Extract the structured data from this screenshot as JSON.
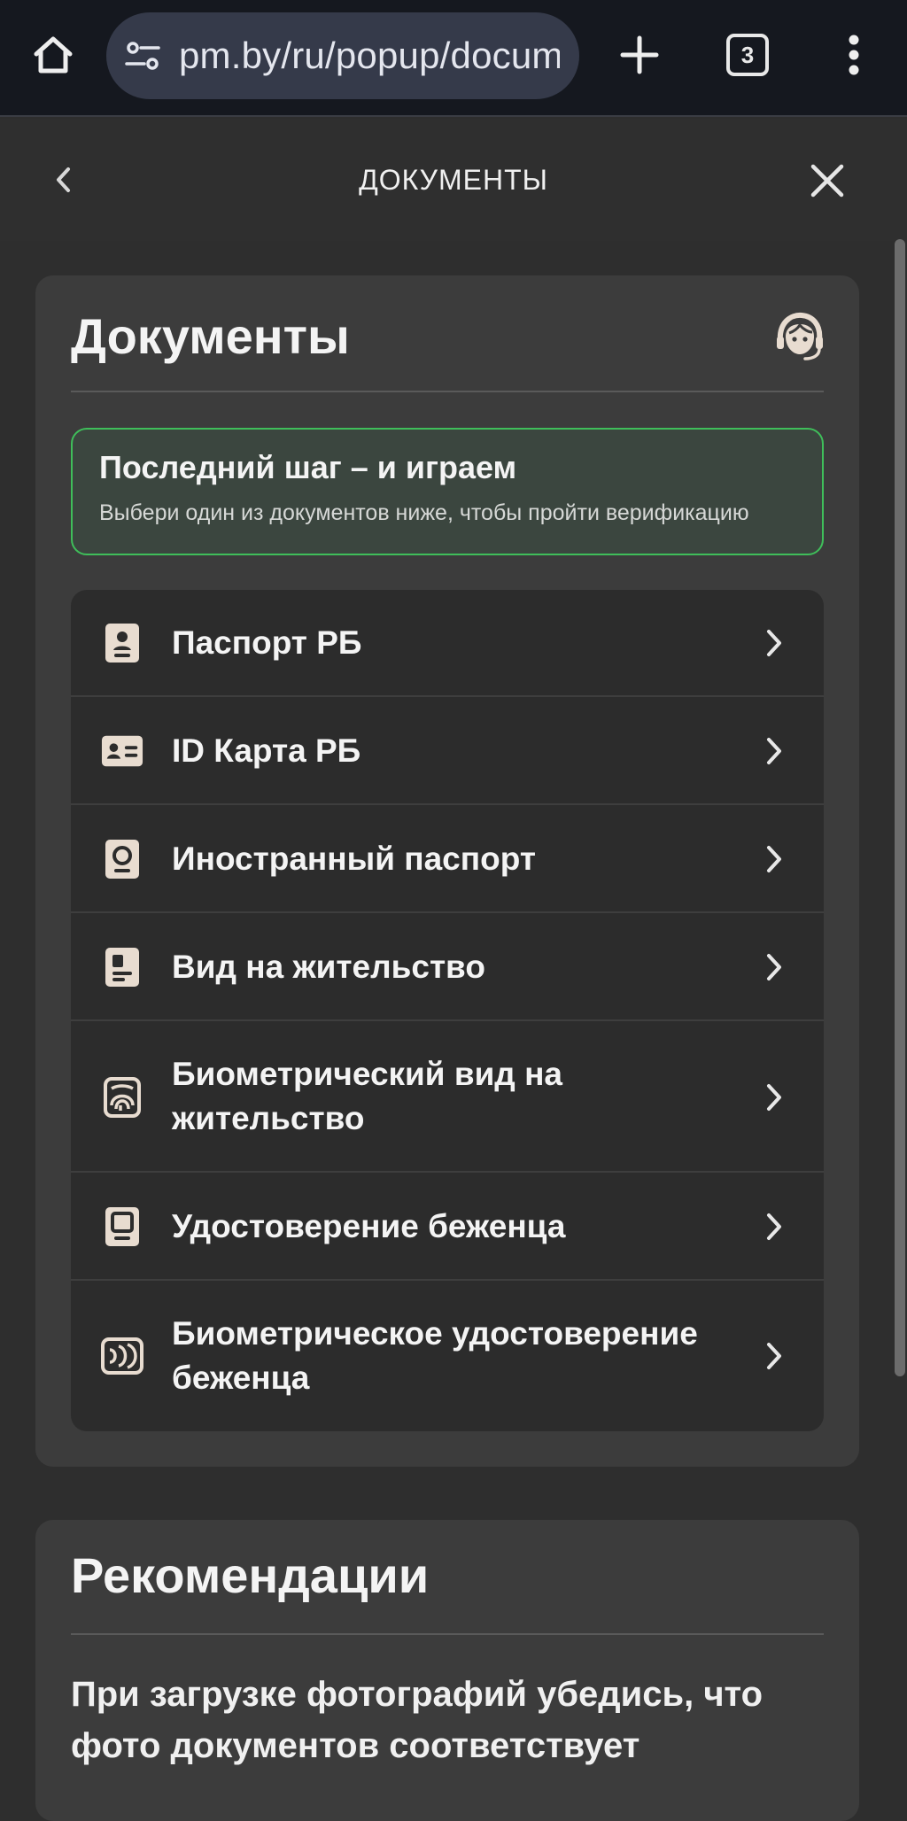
{
  "browser": {
    "url": "pm.by/ru/popup/docume",
    "tab_count": "3"
  },
  "header": {
    "title": "ДОКУМЕНТЫ"
  },
  "documents": {
    "title": "Документы",
    "notice": {
      "title": "Последний шаг – и играем",
      "text": "Выбери один из документов ниже, чтобы пройти верификацию"
    },
    "items": [
      {
        "label": "Паспорт РБ",
        "icon": "passport-icon"
      },
      {
        "label": "ID Карта РБ",
        "icon": "id-card-icon"
      },
      {
        "label": "Иностранный паспорт",
        "icon": "foreign-passport-icon"
      },
      {
        "label": "Вид на жительство",
        "icon": "residence-permit-icon"
      },
      {
        "label": "Биометрический вид на жительство",
        "icon": "biometric-permit-icon"
      },
      {
        "label": "Удостоверение беженца",
        "icon": "refugee-certificate-icon"
      },
      {
        "label": "Биометрическое удостоверение беженца",
        "icon": "biometric-refugee-icon"
      }
    ]
  },
  "recommendations": {
    "title": "Рекомендации",
    "text": "При загрузке фотографий убедись, что фото документов соответствует"
  },
  "colors": {
    "accent_green": "#3fbe5a",
    "icon_beige": "#e8dcd0",
    "background": "#2e2e2e",
    "card": "#3c3c3c"
  }
}
